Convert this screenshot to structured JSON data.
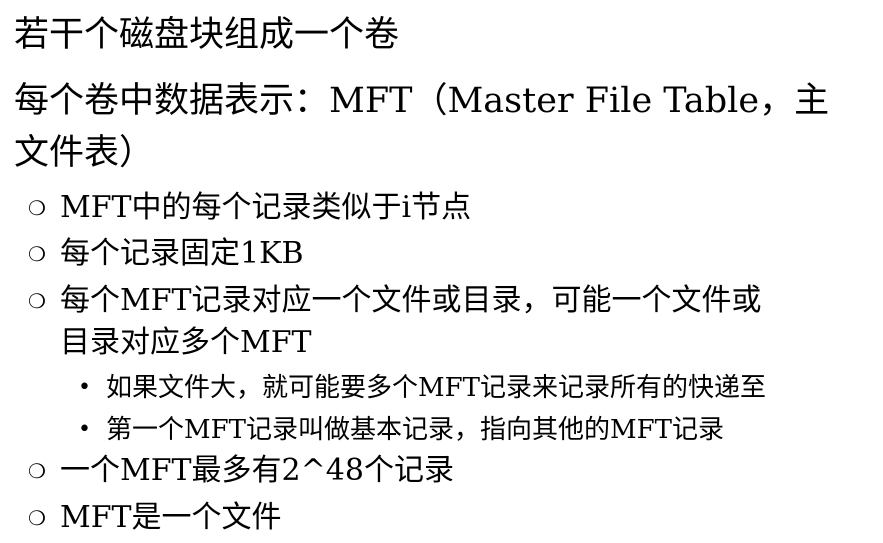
{
  "slide": {
    "lines": [
      {
        "level": 1,
        "text": "若干个磁盘块组成一个卷"
      },
      {
        "level": 1,
        "text": "每个卷中数据表示：MFT（Master File Table，主"
      },
      {
        "level": 1,
        "text": "文件表）"
      },
      {
        "level": 2,
        "bullet": "❍",
        "text": "MFT中的每个记录类似于i节点"
      },
      {
        "level": 2,
        "bullet": "❍",
        "text": "每个记录固定1KB"
      },
      {
        "level": 2,
        "bullet": "❍",
        "text": "每个MFT记录对应一个文件或目录，可能一个文件或"
      },
      {
        "level": 2,
        "text": "目录对应多个MFT"
      },
      {
        "level": 3,
        "bullet": "•",
        "text": "如果文件大，就可能要多个MFT记录来记录所有的快递至"
      },
      {
        "level": 3,
        "bullet": "•",
        "text": "第一个MFT记录叫做基本记录，指向其他的MFT记录"
      },
      {
        "level": 2,
        "bullet": "❍",
        "text": "一个MFT最多有2^48个记录"
      },
      {
        "level": 2,
        "bullet": "❍",
        "text": "MFT是一个文件"
      }
    ]
  }
}
